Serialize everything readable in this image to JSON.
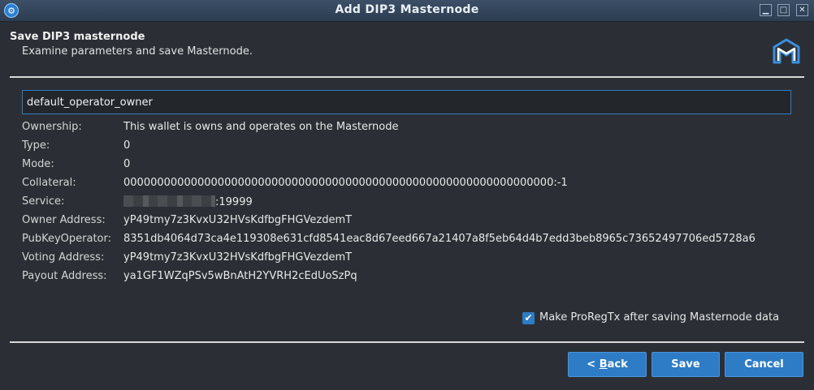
{
  "window": {
    "title": "Add DIP3 Masternode"
  },
  "header": {
    "title": "Save DIP3 masternode",
    "subtitle": "Examine parameters and save Masternode."
  },
  "name_field": {
    "value": "default_operator_owner"
  },
  "params": {
    "ownership": {
      "label": "Ownership:",
      "value": "This wallet is owns and operates on the Masternode"
    },
    "type": {
      "label": "Type:",
      "value": "0"
    },
    "mode": {
      "label": "Mode:",
      "value": "0"
    },
    "collateral": {
      "label": "Collateral:",
      "value": "0000000000000000000000000000000000000000000000000000000000000000:-1"
    },
    "service": {
      "label": "Service:",
      "value_suffix": ":19999"
    },
    "owner_address": {
      "label": "Owner Address:",
      "value": "yP49tmy7z3KvxU32HVsKdfbgFHGVezdemT"
    },
    "pubkey_operator": {
      "label": "PubKeyOperator:",
      "value": "8351db4064d73ca4e119308e631cfd8541eac8d67eed667a21407a8f5eb64d4b7edd3beb8965c73652497706ed5728a6"
    },
    "voting_address": {
      "label": "Voting Address:",
      "value": "yP49tmy7z3KvxU32HVsKdfbgFHGVezdemT"
    },
    "payout_address": {
      "label": "Payout Address:",
      "value": "ya1GF1WZqPSv5wBnAtH2YVRH2cEdUoSzPq"
    }
  },
  "checkbox": {
    "label": "Make ProRegTx after saving Masternode data",
    "checked": true
  },
  "buttons": {
    "back_prefix": "< ",
    "back_mnemonic": "B",
    "back_rest": "ack",
    "save": "Save",
    "cancel": "Cancel"
  },
  "colors": {
    "accent": "#2d7cc5",
    "background": "#2b2f35"
  }
}
